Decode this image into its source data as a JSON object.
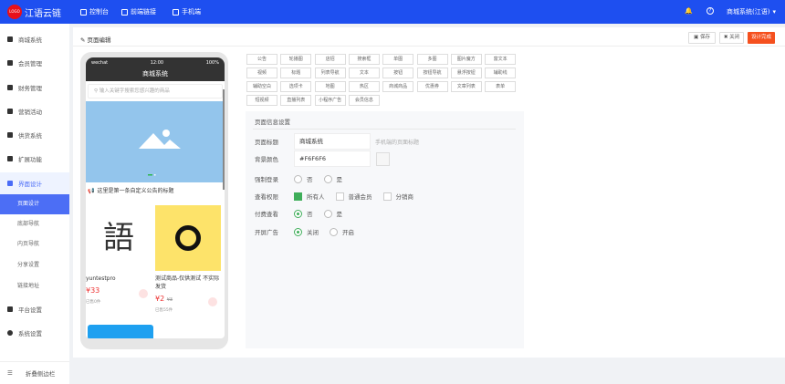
{
  "header": {
    "logo": "LOGO",
    "brand": "江语云链",
    "nav": [
      "控制台",
      "前端链接",
      "手机端"
    ],
    "user": "商城系统(江语)"
  },
  "sidebar": {
    "items": [
      "商城系统",
      "会员管理",
      "财务管理",
      "营销活动",
      "供货系统",
      "扩展功能",
      "界面设计"
    ],
    "sub": [
      "页面设计",
      "底部导航",
      "内页导航",
      "分享设置",
      "链接地址"
    ],
    "items2": [
      "平台设置",
      "系统设置"
    ],
    "collapse": "折叠侧边栏"
  },
  "page": {
    "title": "页面编辑",
    "save": "保存",
    "close": "关闭",
    "finish": "设计完成"
  },
  "phone": {
    "carrier": "wechat",
    "time": "12:00",
    "battery": "100%",
    "title": "商城系统",
    "search_placeholder": "输入关键字搜索您感兴趣的商品",
    "notice": "这里是第一条自定义公告的标题",
    "products": [
      {
        "name": "yuntestpro",
        "price": "¥33",
        "old": "",
        "sold": "已售0件"
      },
      {
        "name": "测试商品-仅供测试 不实际发货",
        "price": "¥2",
        "old": "¥3",
        "sold": "已售55件"
      }
    ]
  },
  "components": [
    "公告",
    "轮播图",
    "店招",
    "搜索框",
    "单图",
    "多图",
    "图片魔方",
    "富文本",
    "视频",
    "标题",
    "列表导航",
    "文本",
    "按钮",
    "按钮导航",
    "悬浮按钮",
    "辅助线",
    "辅助空白",
    "选项卡",
    "地图",
    "热区",
    "商城商品",
    "优惠券",
    "文章列表",
    "表单",
    "短视频",
    "直播列表",
    "小程序广告",
    "会员信息"
  ],
  "settings": {
    "title": "页面信息设置",
    "page_title_label": "页面标题",
    "page_title_value": "商城系统",
    "page_title_hint": "手机端的页面标题",
    "bg_label": "背景颜色",
    "bg_value": "#F6F6F6",
    "login_label": "强制登录",
    "no": "否",
    "yes": "是",
    "view_label": "查看权限",
    "view_opts": [
      "所有人",
      "普通会员",
      "分销商"
    ],
    "pay_label": "付费查看",
    "ad_label": "开屏广告",
    "ad_off": "关闭",
    "ad_on": "开启"
  }
}
